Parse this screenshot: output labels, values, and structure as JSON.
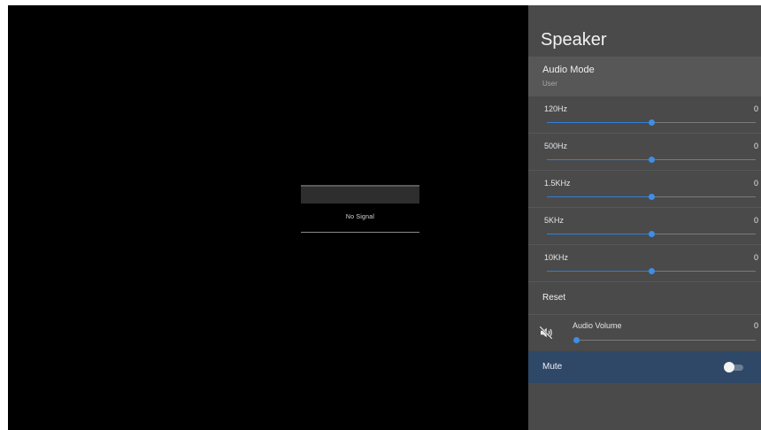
{
  "screen": {
    "no_signal_text": "No Signal"
  },
  "panel": {
    "title": "Speaker",
    "audio_mode": {
      "label": "Audio Mode",
      "value": "User"
    },
    "equalizer": [
      {
        "label": "120Hz",
        "value": "0",
        "level": 0.5
      },
      {
        "label": "500Hz",
        "value": "0",
        "level": 0.5
      },
      {
        "label": "1.5KHz",
        "value": "0",
        "level": 0.5
      },
      {
        "label": "5KHz",
        "value": "0",
        "level": 0.5
      },
      {
        "label": "10KHz",
        "value": "0",
        "level": 0.5
      }
    ],
    "reset_label": "Reset",
    "audio_volume": {
      "label": "Audio Volume",
      "value": "0",
      "level": 0
    },
    "mute": {
      "label": "Mute",
      "enabled": false
    }
  },
  "colors": {
    "accent": "#3f8ee6",
    "selected_row": "#2f4868",
    "panel_bg": "#4a4a4a"
  },
  "icons": {
    "volume": "speaker-muted-icon"
  }
}
